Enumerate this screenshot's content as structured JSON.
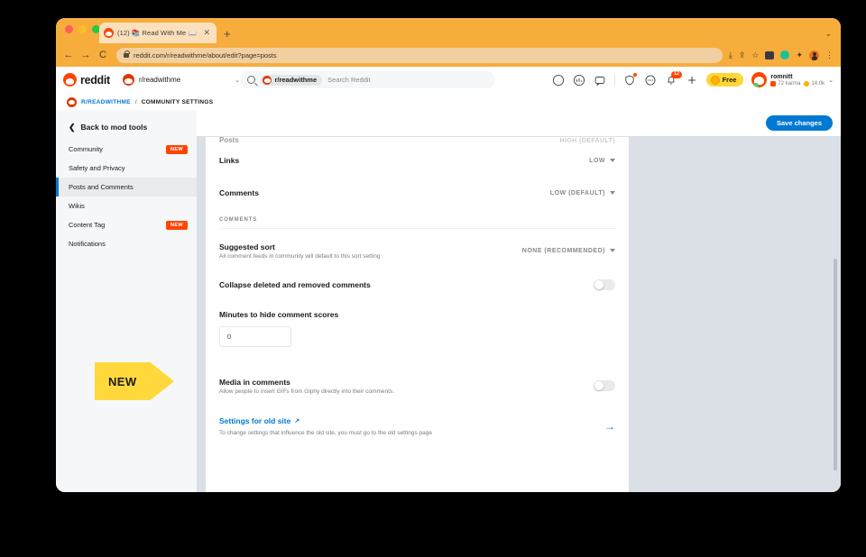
{
  "browser": {
    "tab": {
      "title": "(12) 📚 Read With Me 📖",
      "close_label": "✕",
      "favicon": "reddit-favicon"
    },
    "new_tab_label": "+",
    "window_caret": "⌄",
    "nav": {
      "back": "←",
      "forward": "→",
      "reload": "⟳"
    },
    "url": "reddit.com/r/readwithme/about/edit?page=posts",
    "toolbar_icons": [
      "install-icon",
      "share-icon",
      "bookmark-star-icon",
      "dark-square-extension-icon",
      "grammarly-icon",
      "extensions-puzzle-icon",
      "browser-profile-avatar",
      "kebab-menu-icon"
    ]
  },
  "reddit_nav": {
    "logo_text": "reddit",
    "subreddit_picker": {
      "name": "r/readwithme",
      "caret": "⌄"
    },
    "search": {
      "chip": "r/readwithme",
      "placeholder": "Search Reddit"
    },
    "icons": [
      "explore-compass-icon",
      "advertise-icon",
      "open-chat-icon",
      "shield-mod-icon",
      "chat-bubble-icon",
      "notifications-bell-icon"
    ],
    "notification_count": "12",
    "create_label": "+",
    "free_pill": "Free",
    "user": {
      "name": "romnitt",
      "karma": "72 karma",
      "gold": "14.0k",
      "caret": "⌄"
    }
  },
  "breadcrumb": {
    "subreddit": "R/READWITHME",
    "separator": "/",
    "page": "COMMUNITY SETTINGS"
  },
  "sidebar": {
    "back_label": "Back to mod tools",
    "back_chevron": "❮",
    "items": [
      {
        "label": "Community",
        "badge": "NEW",
        "active": false
      },
      {
        "label": "Safety and Privacy",
        "badge": "",
        "active": false
      },
      {
        "label": "Posts and Comments",
        "badge": "",
        "active": true
      },
      {
        "label": "Wikis",
        "badge": "",
        "active": false
      },
      {
        "label": "Content Tag",
        "badge": "NEW",
        "active": false
      },
      {
        "label": "Notifications",
        "badge": "",
        "active": false
      }
    ]
  },
  "content": {
    "save_label": "Save changes",
    "clipped_row": {
      "label": "Posts",
      "value": "HIGH (DEFAULT)"
    },
    "rows": {
      "links": {
        "label": "Links",
        "value": "LOW"
      },
      "comments": {
        "label": "Comments",
        "value": "LOW (DEFAULT)"
      }
    },
    "section_title": "COMMENTS",
    "suggested_sort": {
      "label": "Suggested sort",
      "desc": "All comment feeds in community will default to this sort setting",
      "value": "NONE (RECOMMENDED)"
    },
    "collapse_comments": {
      "label": "Collapse deleted and removed comments",
      "state": "off"
    },
    "hide_scores": {
      "label": "Minutes to hide comment scores",
      "value": "0"
    },
    "media_in_comments": {
      "label": "Media in comments",
      "desc": "Allow people to insert GIFs from Giphy directly into their comments.",
      "state": "off"
    },
    "old_site": {
      "label": "Settings for old site",
      "external_icon": "↗",
      "desc": "To change settings that influence the old site, you must go to the old settings page",
      "arrow": "→"
    }
  },
  "annotation": {
    "new_label": "NEW"
  },
  "colors": {
    "reddit_orange": "#ff4500",
    "link_blue": "#0079d3",
    "page_bg": "#dae0e6",
    "annotation_yellow": "#ffd93b",
    "browser_chrome": "#f6ad3c"
  }
}
